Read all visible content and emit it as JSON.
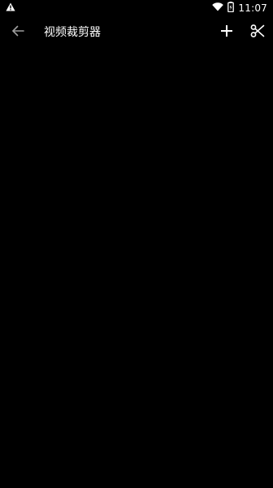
{
  "status_bar": {
    "time": "11:07",
    "icons": [
      "warning-icon",
      "wifi-icon",
      "battery-icon"
    ]
  },
  "app_bar": {
    "title": "视频裁剪器",
    "back_icon": "arrow-back-icon",
    "add_icon": "plus-icon",
    "cut_icon": "scissors-icon"
  },
  "colors": {
    "background": "#000000",
    "foreground": "#ffffff",
    "back_icon": "#9e9e9e"
  }
}
